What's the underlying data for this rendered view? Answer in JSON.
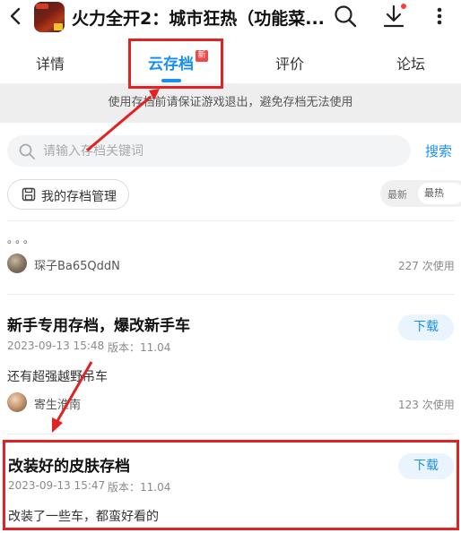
{
  "header": {
    "app_title": "火力全开2：城市狂热（功能菜...",
    "icons": [
      "back-arrow-icon",
      "app-icon",
      "search-icon",
      "download-icon",
      "more-icon"
    ]
  },
  "tabs": [
    {
      "label": "详情",
      "active": false
    },
    {
      "label": "云存档",
      "active": true,
      "badge": "新"
    },
    {
      "label": "评价",
      "active": false
    },
    {
      "label": "论坛",
      "active": false
    }
  ],
  "notice": "使用存档前请保证游戏退出，避免存档无法使用",
  "search": {
    "placeholder": "请输入存档关键词",
    "submit_label": "搜索"
  },
  "manage": {
    "label": "我的存档管理"
  },
  "sort": {
    "new": "最新",
    "hot": "最热"
  },
  "entries": [
    {
      "title": "。。。",
      "author": "琛子Ba65QddN",
      "usage": "227 次使用"
    },
    {
      "title": "新手专用存档，爆改新手车",
      "date": "2023-09-13 15:48",
      "version": "版本：11.04",
      "desc": "还有超强越野吊车",
      "author": "寄生淮南",
      "usage": "123 次使用",
      "download_label": "下载"
    },
    {
      "title": "改装好的皮肤存档",
      "date": "2023-09-13 15:47",
      "version": "版本：11.04",
      "desc": "改装了一些车，都蛮好看的",
      "download_label": "下载"
    }
  ],
  "colors": {
    "accent": "#1a8ff0",
    "annotation": "#e02222",
    "badge": "#f0484a"
  }
}
